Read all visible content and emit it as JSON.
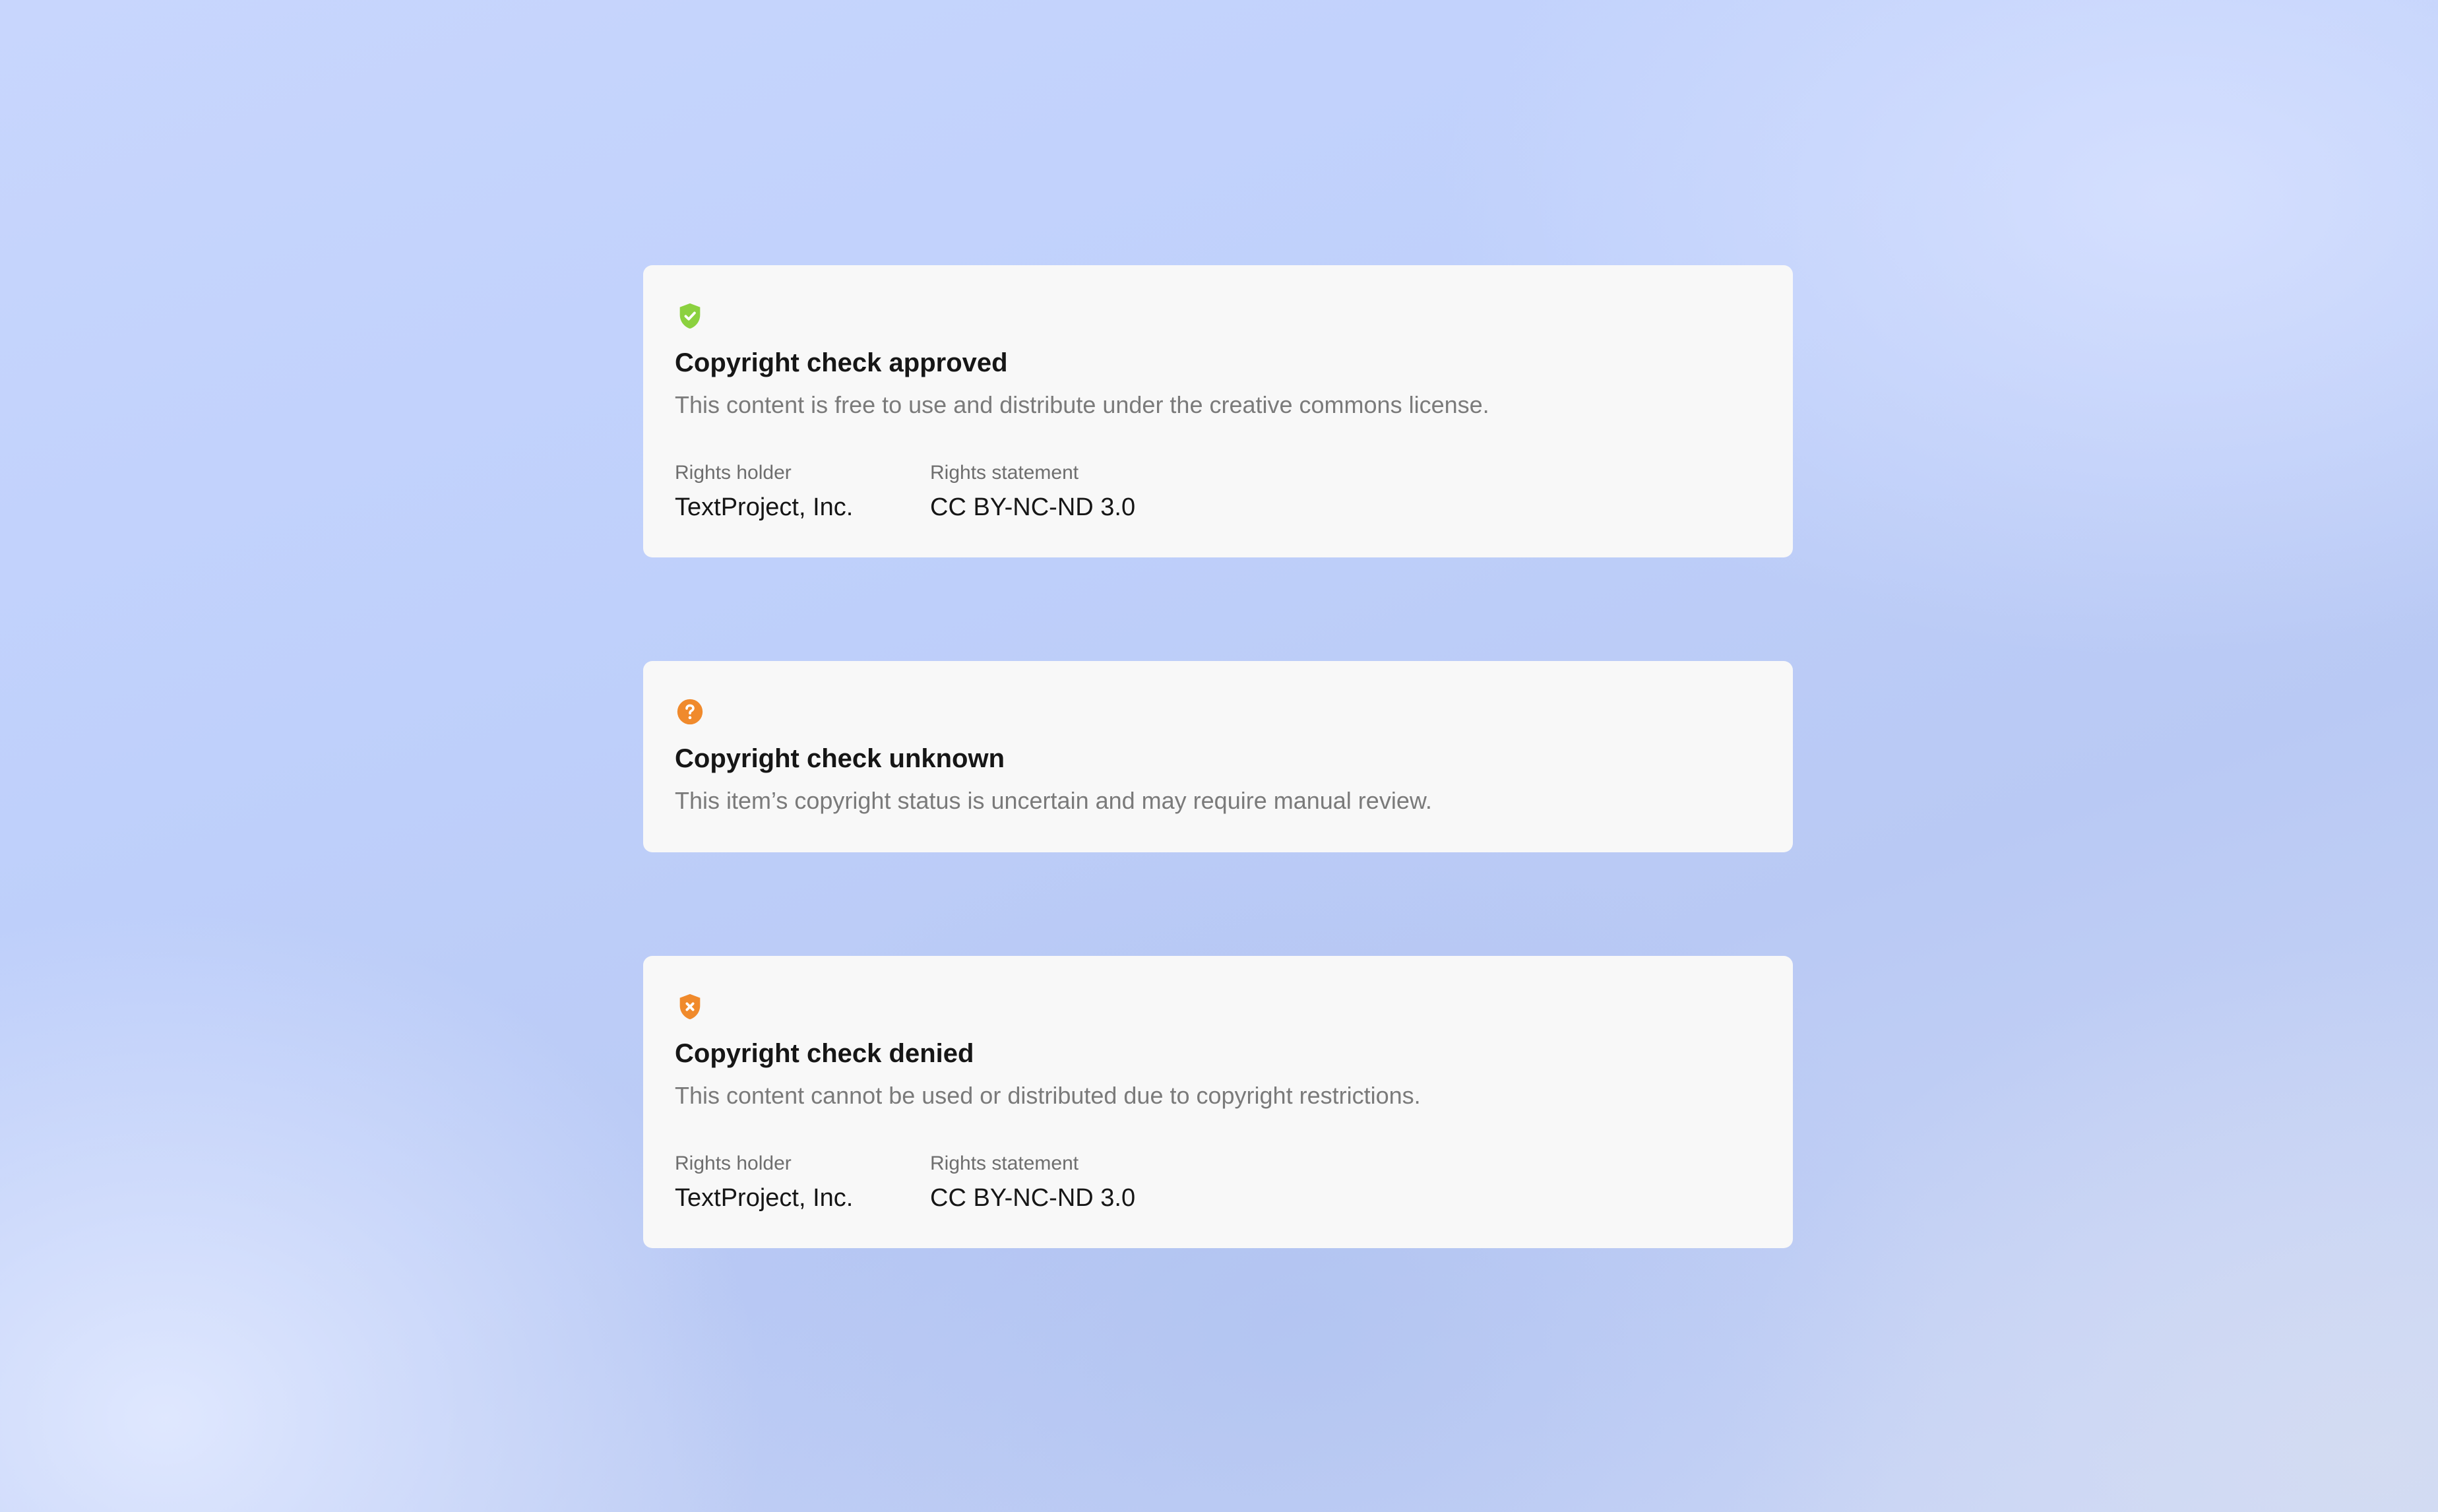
{
  "colors": {
    "approved": "#8bd13f",
    "unknown": "#f08a2c",
    "denied": "#f08a2c"
  },
  "cards": [
    {
      "icon": "shield-check-icon",
      "title": "Copyright check approved",
      "description": "This content is free to use and distribute under the creative commons license.",
      "rights_holder_label": "Rights holder",
      "rights_holder": "TextProject, Inc.",
      "rights_statement_label": "Rights statement",
      "rights_statement": "CC BY-NC-ND 3.0"
    },
    {
      "icon": "question-circle-icon",
      "title": "Copyright check unknown",
      "description": "This item’s copyright status is uncertain and may require manual review."
    },
    {
      "icon": "shield-x-icon",
      "title": "Copyright check denied",
      "description": "This content cannot be used or distributed due to copyright restrictions.",
      "rights_holder_label": "Rights holder",
      "rights_holder": "TextProject, Inc.",
      "rights_statement_label": "Rights statement",
      "rights_statement": "CC BY-NC-ND 3.0"
    }
  ]
}
